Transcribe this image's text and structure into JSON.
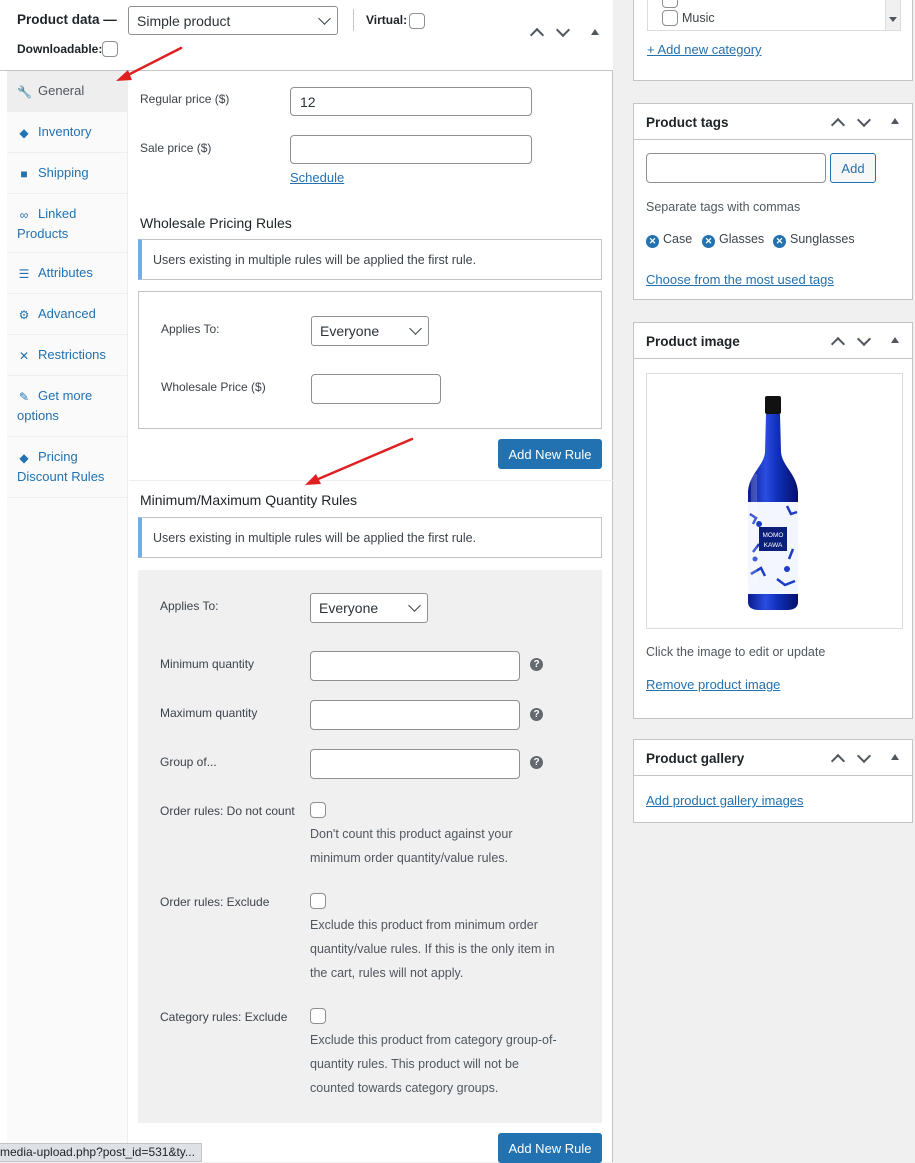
{
  "product_data": {
    "title": "Product data —",
    "type_select": "Simple product",
    "virtual_label": "Virtual:",
    "downloadable_label": "Downloadable:"
  },
  "tabs": [
    {
      "label": "General",
      "icon": "wrench-icon",
      "active": true
    },
    {
      "label": "Inventory",
      "icon": "tag-diamond-icon"
    },
    {
      "label": "Shipping",
      "icon": "truck-icon"
    },
    {
      "label": "Linked Products",
      "icon": "link-icon"
    },
    {
      "label": "Attributes",
      "icon": "list-icon"
    },
    {
      "label": "Advanced",
      "icon": "gear-icon"
    },
    {
      "label": "Restrictions",
      "icon": "shrink-icon"
    },
    {
      "label": "Get more options",
      "icon": "plugin-icon"
    },
    {
      "label": "Pricing Discount Rules",
      "icon": "price-tag-icon"
    }
  ],
  "general": {
    "regular_price_label": "Regular price ($)",
    "regular_price_value": "12",
    "sale_price_label": "Sale price ($)",
    "sale_price_value": "",
    "schedule_link": "Schedule"
  },
  "wholesale": {
    "title": "Wholesale Pricing Rules",
    "notice": "Users existing in multiple rules will be applied the first rule.",
    "applies_to_label": "Applies To:",
    "applies_to_value": "Everyone",
    "price_label": "Wholesale Price ($)",
    "price_value": "",
    "add_rule_button": "Add New Rule"
  },
  "minmax": {
    "title": "Minimum/Maximum Quantity Rules",
    "notice": "Users existing in multiple rules will be applied the first rule.",
    "applies_to_label": "Applies To:",
    "applies_to_value": "Everyone",
    "min_label": "Minimum quantity",
    "max_label": "Maximum quantity",
    "group_label": "Group of...",
    "order_nocount_label": "Order rules: Do not count",
    "order_nocount_desc": [
      "Don't count this product against your",
      "minimum order quantity/value rules."
    ],
    "order_exclude_label": "Order rules: Exclude",
    "order_exclude_desc": [
      "Exclude this product from minimum order",
      "quantity/value rules. If this is the only item in",
      "the cart, rules will not apply."
    ],
    "category_exclude_label": "Category rules: Exclude",
    "category_exclude_desc": [
      "Exclude this product from category group-of-",
      "quantity rules. This product will not be",
      "counted towards category groups."
    ],
    "add_rule_button": "Add New Rule"
  },
  "categories": {
    "last_item": "Music",
    "add_new_link": "+ Add new category"
  },
  "product_tags": {
    "title": "Product tags",
    "input_value": "",
    "add_button": "Add",
    "hint": "Separate tags with commas",
    "tags": [
      "Case",
      "Glasses",
      "Sunglasses"
    ],
    "choose_link": "Choose from the most used tags"
  },
  "product_image": {
    "title": "Product image",
    "label_top": "MOMO",
    "label_bottom": "KAWA",
    "hint": "Click the image to edit or update",
    "remove_link": "Remove product image"
  },
  "product_gallery": {
    "title": "Product gallery",
    "add_link": "Add product gallery images"
  },
  "status_bar": "media-upload.php?post_id=531&ty...",
  "colors": {
    "accent": "#2271b1",
    "annotation_arrow": "#e02020"
  }
}
